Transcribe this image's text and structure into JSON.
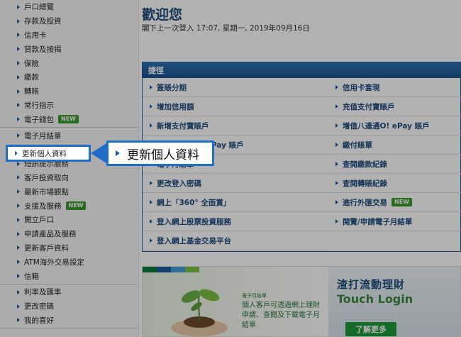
{
  "sidebar": {
    "groups": [
      {
        "items": [
          {
            "label": "戶口總覽"
          },
          {
            "label": "存款及投資"
          },
          {
            "label": "信用卡"
          },
          {
            "label": "貸款及按揭"
          },
          {
            "label": "保險"
          },
          {
            "label": "繳款"
          },
          {
            "label": "轉賬"
          },
          {
            "label": "常行指示"
          },
          {
            "label": "電子錢包",
            "badge": "NEW"
          }
        ]
      },
      {
        "items": [
          {
            "label": "電子月結單"
          },
          {
            "label": "更新個人資料"
          },
          {
            "label": "短訊提示服務"
          },
          {
            "label": "客戶投資取向"
          },
          {
            "label": "最新市場觀點"
          },
          {
            "label": "支援及服務",
            "badge": "NEW"
          },
          {
            "label": "開立戶口"
          },
          {
            "label": "申請產品及服務"
          },
          {
            "label": "更新客戶資料"
          },
          {
            "label": "ATM海外交易設定"
          },
          {
            "label": "信箱"
          }
        ]
      },
      {
        "items": [
          {
            "label": "利率及匯率"
          },
          {
            "label": "更改密碼"
          },
          {
            "label": "我的喜好"
          }
        ]
      }
    ]
  },
  "main": {
    "welcome": "歡迎您",
    "last_login": "閣下上一次登入 17:07, 星期一, 2019年09月16日"
  },
  "shortcuts": {
    "title": "捷徑",
    "rows": [
      [
        {
          "label": "簽賬分期"
        },
        {
          "label": "信用卡套現"
        }
      ],
      [
        {
          "label": "增加信用額"
        },
        {
          "label": "充值支付寶賬戶"
        }
      ],
      [
        {
          "label": "新增支付寶賬戶"
        },
        {
          "label": "增值八達通O! ePay 賬戶"
        }
      ],
      [
        {
          "label": "新增八達通O! ePay 賬戶"
        },
        {
          "label": "繳付賬單"
        }
      ],
      [
        {
          "label": "電子月結單"
        },
        {
          "label": "查閱繳款紀錄"
        }
      ],
      [
        {
          "label": "更改登入密碼"
        },
        {
          "label": "查閱轉賬紀錄"
        }
      ],
      [
        {
          "label": "網上「360° 全面賞」"
        },
        {
          "label": "進行外匯交易",
          "badge": "NEW"
        }
      ],
      [
        {
          "label": "登入網上股票投資服務"
        },
        {
          "label": "閱覽/申請電子月結單"
        }
      ],
      [
        {
          "label": "登入網上基金交易平台"
        },
        null
      ]
    ]
  },
  "banner": {
    "small_label": "電子月結單",
    "text": "個人客戶可透過網上理財申請、查閱及下載電子月結單",
    "right_title": "渣打流動理財",
    "right_sub": "Touch Login",
    "button": "了解更多"
  },
  "highlight": {
    "label": "更新個人資料"
  },
  "callout": {
    "label": "更新個人資料"
  },
  "colors": {
    "brand": "#1d4c7d",
    "accent": "#1f6fc9",
    "new_badge": "#3c9a2e"
  }
}
